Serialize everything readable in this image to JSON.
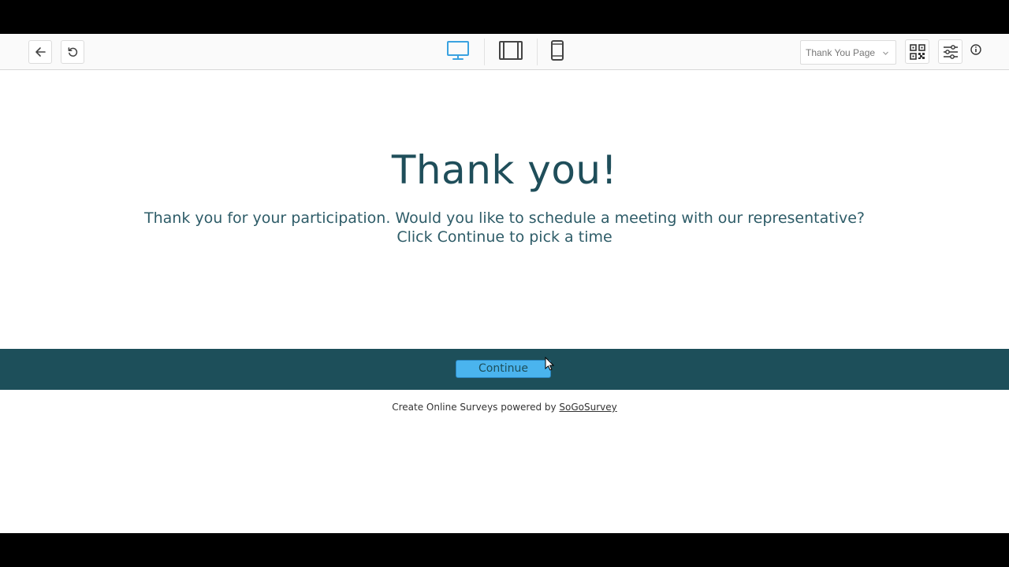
{
  "toolbar": {
    "back_icon": "arrow-left-icon",
    "reset_icon": "rotate-ccw-icon",
    "devices": [
      {
        "name": "desktop",
        "icon": "monitor-icon",
        "active": true
      },
      {
        "name": "tablet",
        "icon": "tablet-icon",
        "active": false
      },
      {
        "name": "mobile",
        "icon": "phone-icon",
        "active": false
      }
    ],
    "page_select": {
      "value": "Thank You Page"
    },
    "qr_icon": "qr-code-icon",
    "settings_icon": "sliders-icon",
    "info_icon": "info-icon"
  },
  "survey": {
    "title": "Thank you!",
    "message_line1": "Thank you for your participation. Would you like to schedule a meeting with our representative?",
    "message_line2": "Click Continue to pick a time",
    "continue_label": "Continue"
  },
  "footer": {
    "text": "Create Online Surveys powered by ",
    "link": "SoGoSurvey"
  },
  "colors": {
    "accent": "#4ab4ee",
    "band": "#1d4f5a",
    "title": "#1f4e5a",
    "active_device": "#3aa2e0"
  }
}
